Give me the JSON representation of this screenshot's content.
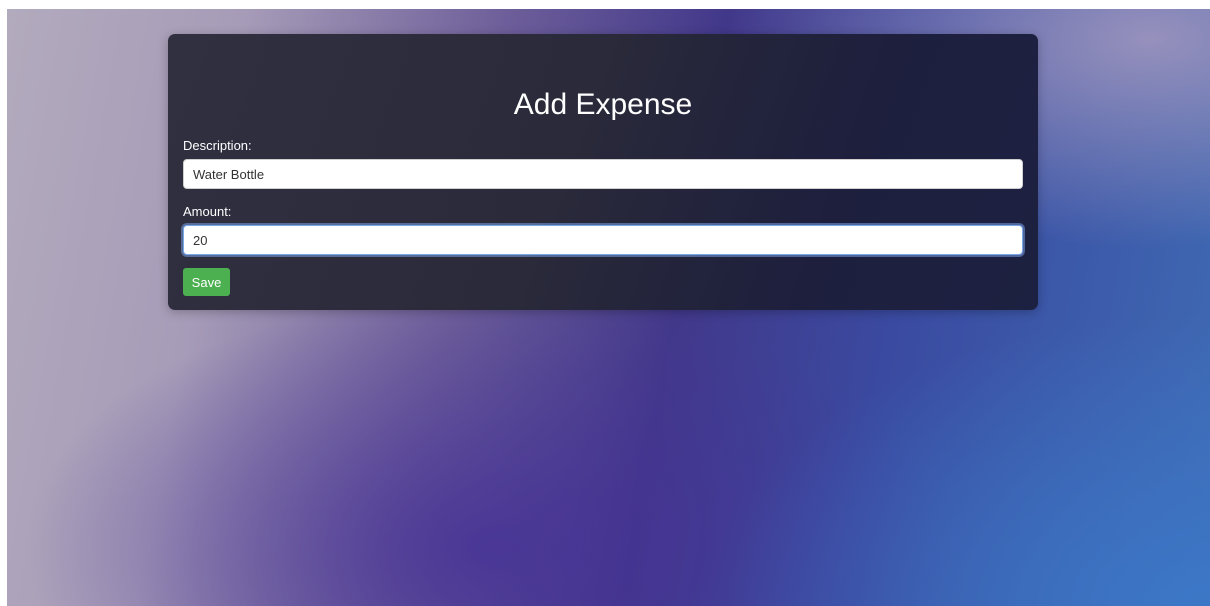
{
  "form": {
    "title": "Add Expense",
    "description_label": "Description:",
    "description_value": "Water Bottle",
    "amount_label": "Amount:",
    "amount_value": "20",
    "save_label": "Save"
  },
  "colors": {
    "card_background": "#2c2c3c",
    "save_button": "#4caf50",
    "focus_ring": "#7aa7e6"
  }
}
